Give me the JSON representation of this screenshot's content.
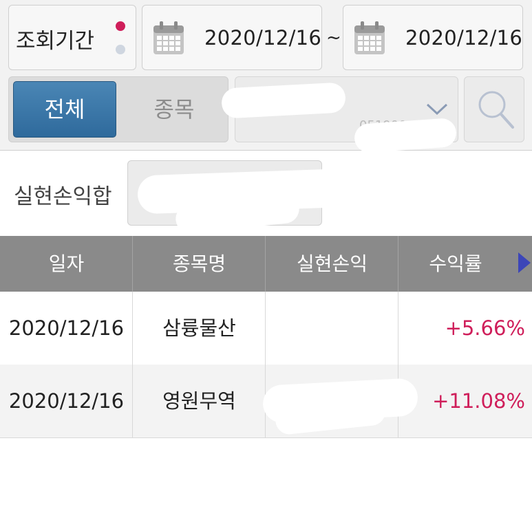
{
  "period": {
    "label": "조회기간"
  },
  "date_range": {
    "start": "2020/12/16",
    "end": "2020/12/16",
    "separator": "~"
  },
  "filter": {
    "all_label": "전체",
    "stock_label": "종목",
    "selected_stock_code": "051900"
  },
  "summary": {
    "label": "실현손익합",
    "value": ""
  },
  "table": {
    "headers": [
      "일자",
      "종목명",
      "실현손익",
      "수익률"
    ],
    "rows": [
      {
        "date": "2020/12/16",
        "name": "삼륭물산",
        "realized_pl": "",
        "return_rate": "+5.66%"
      },
      {
        "date": "2020/12/16",
        "name": "영원무역",
        "realized_pl": "",
        "return_rate": "+11.08%"
      }
    ]
  },
  "colors": {
    "accent_blue": "#2f6a9c",
    "positive_red": "#cf1e5a",
    "header_gray": "#8a8a8a"
  }
}
